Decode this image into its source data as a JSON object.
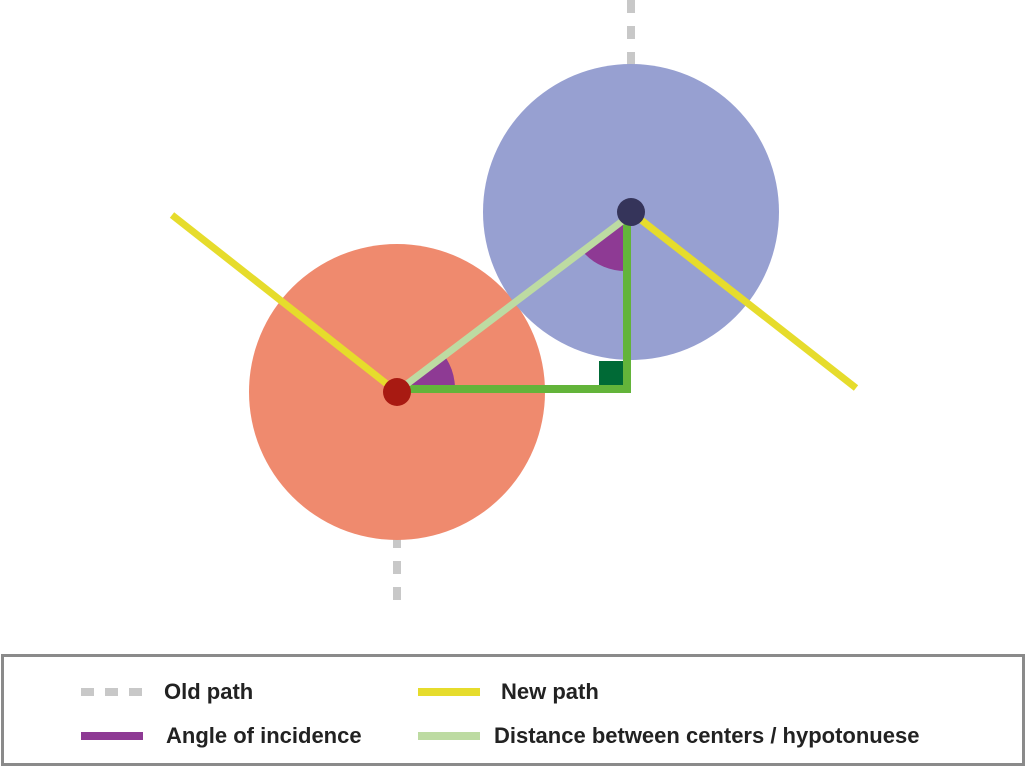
{
  "colors": {
    "old_path": "#c8c8c8",
    "new_path": "#e6dc2c",
    "angle": "#8e3a94",
    "hypotenuse": "#bddba2",
    "legs": "#63b43a",
    "right_angle_marker": "#006a36",
    "circle_a": "#ef8a6e",
    "circle_a_center": "#a81a12",
    "circle_b": "#97a0d1",
    "circle_b_center": "#35345a",
    "legend_border": "#8a8a8a"
  },
  "legend": {
    "old_path": "Old path",
    "new_path": "New path",
    "angle": "Angle of incidence",
    "hypotenuse": "Distance between centers / hypotonuese"
  }
}
